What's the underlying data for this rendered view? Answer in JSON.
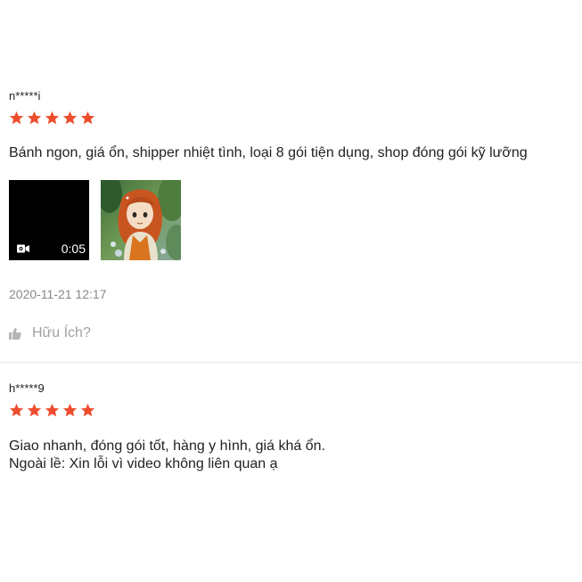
{
  "colors": {
    "star": "#ee4d2d",
    "muted": "#888888",
    "divider": "#e5e5e5"
  },
  "reviews": [
    {
      "username": "n*****i",
      "rating": 5,
      "comment": "Bánh ngon, giá ổn, shipper nhiệt tình, loại 8 gói tiện dụng, shop đóng gói kỹ lưỡng",
      "video_duration": "0:05",
      "timestamp": "2020-11-21 12:17",
      "helpful_label": "Hữu Ích?"
    },
    {
      "username": "h*****9",
      "rating": 5,
      "comment": "Giao nhanh, đóng gói tốt, hàng y hình, giá khá ổn.\nNgoài lề: Xin lỗi vì video không liên quan ạ"
    }
  ],
  "icons": {
    "star": "star-icon",
    "video": "video-camera-icon",
    "helpful": "thumbs-up-icon"
  }
}
